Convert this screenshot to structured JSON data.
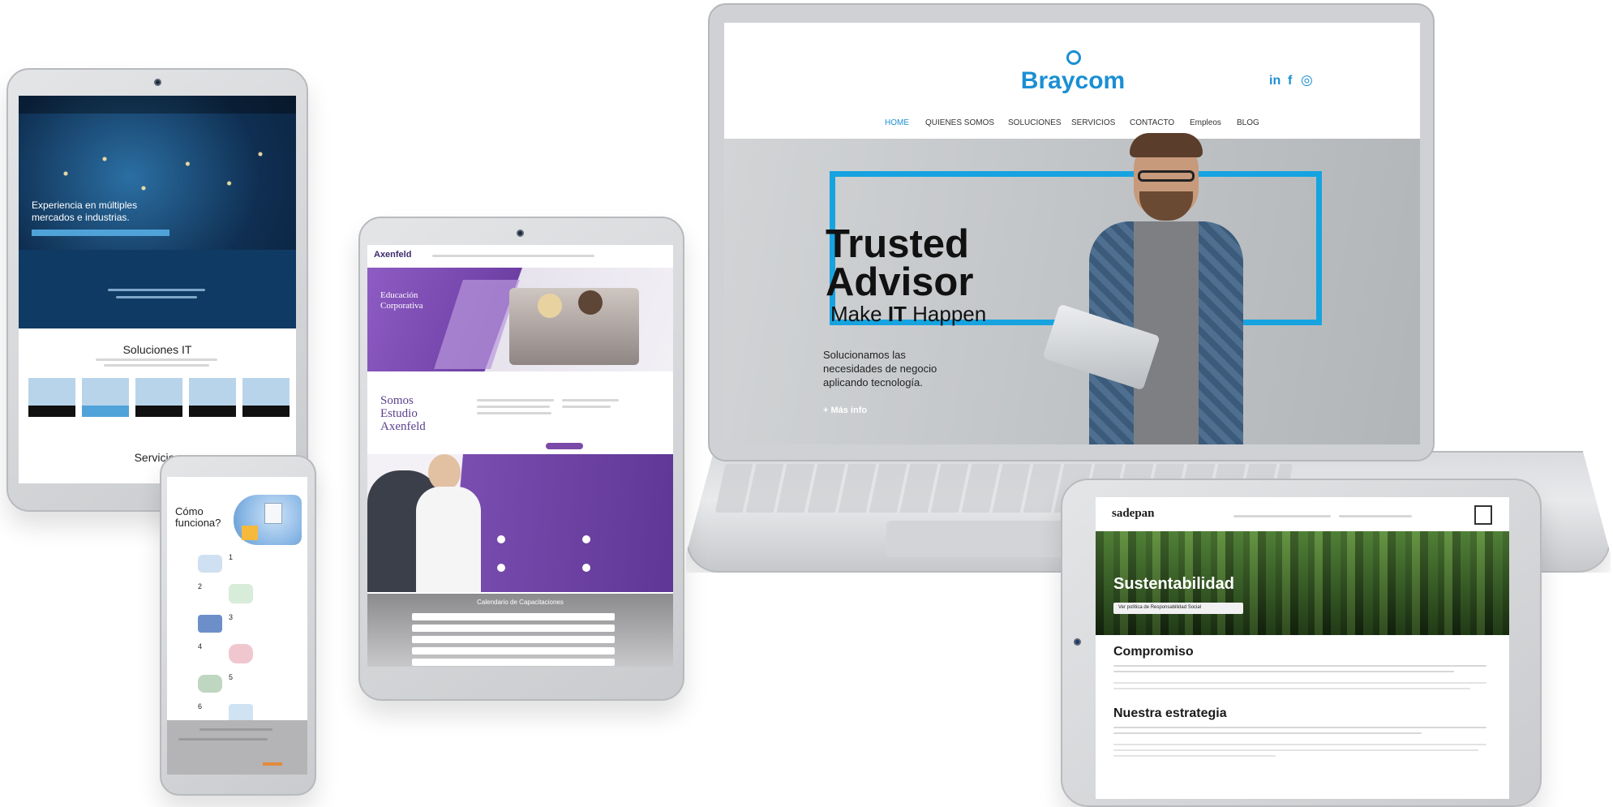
{
  "laptop": {
    "brand": "Braycom",
    "social": [
      "in",
      "f",
      "◎"
    ],
    "nav": [
      "HOME",
      "QUIENES SOMOS",
      "SOLUCIONES",
      "SERVICIOS",
      "CONTACTO",
      "Empleos",
      "BLOG"
    ],
    "hero_title_1": "Trusted",
    "hero_title_2": "Advisor",
    "hero_sub_pre": "Make ",
    "hero_sub_bold": "IT",
    "hero_sub_post": " Happen",
    "hero_text_1": "Solucionamos las",
    "hero_text_2": "necesidades de negocio",
    "hero_text_3": "aplicando tecnología.",
    "hero_cta": "+ Más info",
    "colors": {
      "accent": "#16a3e0",
      "brand": "#1b8fd3"
    }
  },
  "tablet_left": {
    "hero_title_1": "Experiencia en múltiples",
    "hero_title_2": "mercados e industrias.",
    "section_title": "Soluciones IT",
    "section_title_2": "Servicios"
  },
  "tablet_mid": {
    "brand": "Axenfeld",
    "hero_title_1": "Educación",
    "hero_title_2": "Corporativa",
    "somos_1": "Somos",
    "somos_2": "Estudio",
    "somos_3": "Axenfeld",
    "table_title": "Calendario de Capacitaciones"
  },
  "phone": {
    "title_1": "Cómo",
    "title_2": "funciona?",
    "steps": [
      "1",
      "2",
      "3",
      "4",
      "5",
      "6"
    ]
  },
  "tablet_right": {
    "brand": "sadepan",
    "hero_title": "Sustentabilidad",
    "hero_button": "Ver política de Responsabilidad Social",
    "h1": "Compromiso",
    "h2": "Nuestra estrategia"
  }
}
